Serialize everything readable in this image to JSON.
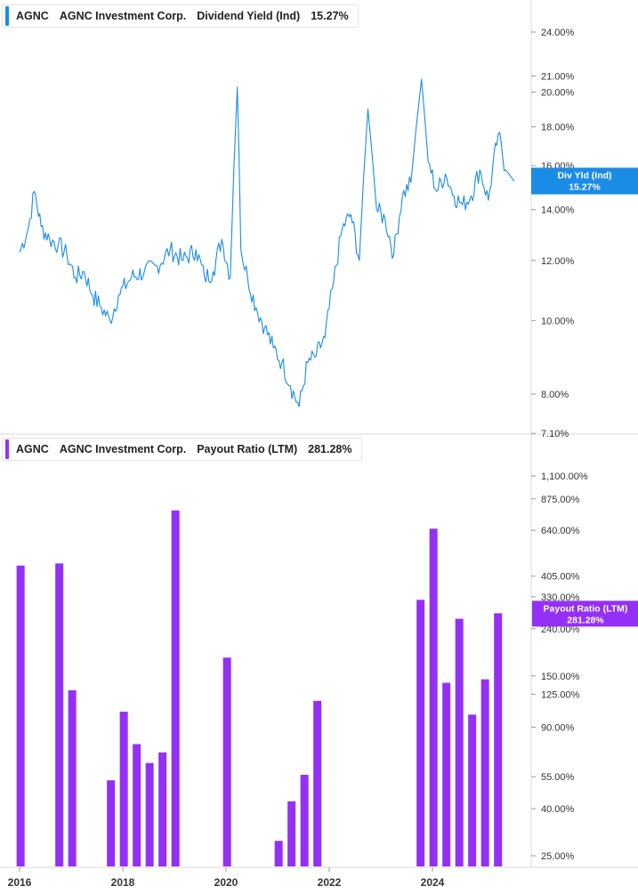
{
  "top_legend": {
    "ticker": "AGNC",
    "company": "AGNC Investment Corp.",
    "metric": "Dividend Yield (Ind)",
    "value": "15.27%",
    "color": "#1a8ce6"
  },
  "bottom_legend": {
    "ticker": "AGNC",
    "company": "AGNC Investment Corp.",
    "metric": "Payout Ratio (LTM)",
    "value": "281.28%",
    "color": "#9430f5"
  },
  "top_flag": {
    "label": "Div Yld (Ind)",
    "value": "15.27%"
  },
  "bottom_flag": {
    "label": "Payout Ratio (LTM)",
    "value": "281.28%"
  },
  "x_axis_labels": [
    "2016",
    "2018",
    "2020",
    "2022",
    "2024"
  ],
  "chart_data": [
    {
      "type": "line",
      "title": "",
      "series_name": "Dividend Yield (Ind)",
      "color": "#1a8ce6",
      "scale": "log",
      "y_ticks": [
        "24.00%",
        "21.00%",
        "20.00%",
        "18.00%",
        "16.00%",
        "14.00%",
        "12.00%",
        "10.00%",
        "8.00%",
        "7.10%"
      ],
      "y_tick_values": [
        24,
        21,
        20,
        18,
        16,
        14,
        12,
        10,
        8,
        7.1
      ],
      "ylim": [
        7.1,
        28
      ],
      "x": [
        "2016-01-01",
        "2016-03-01",
        "2016-04-15",
        "2016-06-01",
        "2016-08-01",
        "2016-10-01",
        "2016-12-01",
        "2017-02-01",
        "2017-04-01",
        "2017-06-01",
        "2017-08-01",
        "2017-10-01",
        "2017-12-01",
        "2018-03-01",
        "2018-06-01",
        "2018-09-01",
        "2018-12-01",
        "2019-03-01",
        "2019-06-01",
        "2019-08-01",
        "2019-10-01",
        "2019-12-01",
        "2020-02-01",
        "2020-03-20",
        "2020-04-15",
        "2020-06-01",
        "2020-08-01",
        "2020-10-01",
        "2020-12-01",
        "2021-02-01",
        "2021-04-01",
        "2021-06-01",
        "2021-08-01",
        "2021-10-01",
        "2021-12-01",
        "2022-02-01",
        "2022-04-01",
        "2022-06-01",
        "2022-08-01",
        "2022-10-01",
        "2022-12-01",
        "2023-02-01",
        "2023-04-01",
        "2023-06-01",
        "2023-08-01",
        "2023-10-15",
        "2023-12-01",
        "2024-02-01",
        "2024-04-01",
        "2024-06-01",
        "2024-08-01",
        "2024-10-01",
        "2024-12-01",
        "2025-02-01",
        "2025-04-10",
        "2025-06-01",
        "2025-08-01"
      ],
      "values": [
        12.3,
        13.2,
        14.8,
        13.3,
        12.8,
        12.6,
        12.2,
        11.4,
        11.6,
        10.8,
        10.4,
        10.0,
        10.8,
        11.4,
        11.6,
        11.8,
        12.4,
        12.0,
        12.4,
        11.4,
        11.6,
        12.8,
        11.4,
        20.3,
        12.4,
        11.4,
        10.4,
        9.8,
        9.2,
        8.8,
        8.2,
        7.7,
        8.8,
        9.0,
        9.5,
        11.2,
        13.2,
        13.8,
        12.0,
        19.0,
        14.0,
        13.6,
        12.2,
        14.6,
        15.2,
        20.8,
        16.2,
        14.8,
        15.6,
        14.6,
        14.2,
        14.6,
        15.8,
        14.4,
        17.6,
        15.8,
        15.27
      ]
    },
    {
      "type": "bar",
      "title": "",
      "series_name": "Payout Ratio (LTM)",
      "color": "#9430f5",
      "scale": "log",
      "y_ticks": [
        "1,100.00%",
        "875.00%",
        "640.00%",
        "405.00%",
        "330.00%",
        "240.00%",
        "150.00%",
        "125.00%",
        "90.00%",
        "55.00%",
        "40.00%",
        "25.00%"
      ],
      "y_tick_values": [
        1100,
        875,
        640,
        405,
        330,
        240,
        150,
        125,
        90,
        55,
        40,
        25
      ],
      "ylim": [
        23,
        1300
      ],
      "x": [
        "2016-Q1",
        "2016-Q4",
        "2017-Q1",
        "2017-Q4",
        "2018-Q1",
        "2018-Q2",
        "2018-Q3",
        "2018-Q4",
        "2019-Q1",
        "2020-Q1",
        "2021-Q1",
        "2021-Q2",
        "2021-Q3",
        "2021-Q4",
        "2023-Q4",
        "2024-Q1",
        "2024-Q2",
        "2024-Q3",
        "2024-Q4",
        "2025-Q1",
        "2025-Q2"
      ],
      "values": [
        450,
        460,
        130,
        53,
        105,
        76,
        63,
        70,
        780,
        180,
        29,
        43,
        56,
        117,
        320,
        650,
        140,
        265,
        102,
        145,
        280
      ]
    }
  ]
}
